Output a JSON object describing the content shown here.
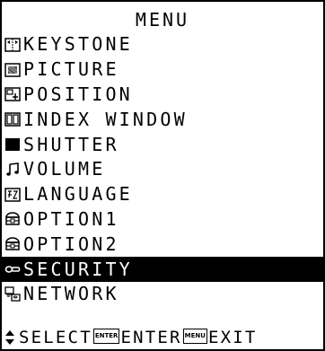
{
  "menu": {
    "title": "MENU",
    "items": [
      {
        "label": "KEYSTONE",
        "icon": "keystone-icon"
      },
      {
        "label": "PICTURE",
        "icon": "picture-icon"
      },
      {
        "label": "POSITION",
        "icon": "position-icon"
      },
      {
        "label": "INDEX WINDOW",
        "icon": "index-window-icon"
      },
      {
        "label": "SHUTTER",
        "icon": "shutter-icon"
      },
      {
        "label": "VOLUME",
        "icon": "volume-icon"
      },
      {
        "label": "LANGUAGE",
        "icon": "language-icon"
      },
      {
        "label": "OPTION1",
        "icon": "option-icon"
      },
      {
        "label": "OPTION2",
        "icon": "option-icon"
      },
      {
        "label": "SECURITY",
        "icon": "key-icon",
        "selected": true
      },
      {
        "label": "NETWORK",
        "icon": "network-icon"
      }
    ]
  },
  "footer": {
    "select_label": "SELECT",
    "enter_key": "ENTER",
    "enter_label": "ENTER",
    "menu_key": "MENU",
    "exit_label": "EXIT"
  },
  "colors": {
    "background": "#ffffff",
    "foreground": "#000000",
    "highlight": "#000000"
  }
}
